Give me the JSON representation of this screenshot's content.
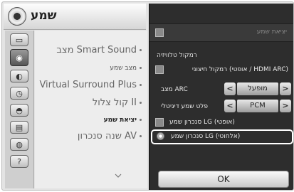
{
  "header": {
    "title": "שמע",
    "icon": "speaker-icon"
  },
  "sidebar": {
    "icons": [
      "tv-icon",
      "speaker-icon",
      "globe-icon",
      "clock-icon",
      "lock-icon",
      "keyboard-icon",
      "network-icon",
      "help-icon"
    ]
  },
  "menu": {
    "items": [
      {
        "label": "מצב Smart Sound",
        "size": "big"
      },
      {
        "label": "מצב שמע",
        "size": "small"
      },
      {
        "label": "Virtual Surround Plus",
        "size": "big"
      },
      {
        "label": "קול צלול II",
        "size": "big"
      },
      {
        "label": "יציאת שמע",
        "size": "small",
        "selected": true
      },
      {
        "label": "שנה סנכרון AV",
        "size": "big"
      }
    ]
  },
  "panel": {
    "exit_label": "יציאת שמע",
    "section_label": "רמקול טלוויזיה",
    "hdmi_arc_label": "רמקול חיצוני (אופטי / HDMI ARC)",
    "arc_mode_label": "מצב ARC",
    "arc_mode_value": "מופעל",
    "digital_out_label": "פלט שמע דיגיטלי",
    "digital_out_value": "PCM",
    "lg_optical_label": "סנכרון שמע LG (אופטי)",
    "lg_wireless_label": "סנכרון שמע LG (אלחוטי)",
    "left_arrow": "<",
    "right_arrow": ">",
    "ok_label": "OK"
  },
  "colors": {
    "panel_bg": "#2d2d2d",
    "menu_bg": "#ededed",
    "highlight": "#ffffff"
  }
}
